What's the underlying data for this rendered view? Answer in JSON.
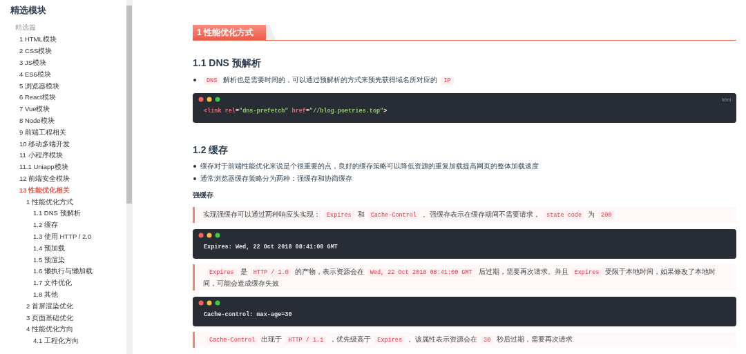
{
  "sidebar": {
    "title": "精选模块",
    "group": "精选篇",
    "items": [
      {
        "label": "1 HTML模块",
        "selected": false
      },
      {
        "label": "2 CSS模块",
        "selected": false
      },
      {
        "label": "3 JS模块",
        "selected": false
      },
      {
        "label": "4 ES6模块",
        "selected": false
      },
      {
        "label": "5 浏览器模块",
        "selected": false
      },
      {
        "label": "6 React模块",
        "selected": false
      },
      {
        "label": "7 Vue模块",
        "selected": false
      },
      {
        "label": "8 Node模块",
        "selected": false
      },
      {
        "label": "9 前端工程相关",
        "selected": false
      },
      {
        "label": "10 移动多端开发",
        "selected": false
      },
      {
        "label": "11 小程序模块",
        "selected": false
      },
      {
        "label": "11.1 Uniapp模块",
        "selected": false
      },
      {
        "label": "12 前端安全模块",
        "selected": false
      },
      {
        "label": "13 性能优化相关",
        "selected": true,
        "children": [
          {
            "label": "1 性能优化方式",
            "selected": false,
            "children": [
              {
                "label": "1.1 DNS 预解析",
                "selected": false
              },
              {
                "label": "1.2 缓存",
                "selected": false
              },
              {
                "label": "1.3 使用 HTTP / 2.0",
                "selected": false
              },
              {
                "label": "1.4 预加载",
                "selected": false
              },
              {
                "label": "1.5 预渲染",
                "selected": false
              },
              {
                "label": "1.6 懒执行与懒加载",
                "selected": false
              },
              {
                "label": "1.7 文件优化",
                "selected": false
              },
              {
                "label": "1.8 其他",
                "selected": false
              }
            ]
          },
          {
            "label": "2 首屏渲染优化",
            "selected": false
          },
          {
            "label": "3 页面基础优化",
            "selected": false
          },
          {
            "label": "4 性能优化方向",
            "selected": false,
            "children": [
              {
                "label": "4.1 工程化方向",
                "selected": false
              }
            ]
          }
        ]
      }
    ]
  },
  "article": {
    "blocks": [
      {
        "kind": "section_title",
        "text": "1 性能优化方式"
      },
      {
        "kind": "heading",
        "text": "1.1 DNS 预解析"
      },
      {
        "kind": "bullets",
        "items": [
          {
            "parts": [
              {
                "kind": "code",
                "text": "DNS"
              },
              {
                "kind": "text",
                "text": "解析也是需要时间的，可以通过预解析的方式来预先获得域名所对应的"
              },
              {
                "kind": "code",
                "text": "IP"
              }
            ]
          }
        ]
      },
      {
        "kind": "code",
        "language": "html",
        "lines": [
          [
            {
              "kind": "tag",
              "text": "<link"
            },
            {
              "kind": "attr",
              "text": "rel"
            },
            {
              "kind": "plain",
              "text": "="
            },
            {
              "kind": "string",
              "text": "\"dns-prefetch\""
            },
            {
              "kind": "attr",
              "text": "href"
            },
            {
              "kind": "plain",
              "text": "="
            },
            {
              "kind": "string",
              "text": "\"//blog.poetries.top\""
            },
            {
              "kind": "plain",
              "text": ">"
            }
          ]
        ]
      },
      {
        "kind": "heading",
        "text": "1.2 缓存"
      },
      {
        "kind": "bullets",
        "items": [
          {
            "parts": [
              {
                "kind": "text",
                "text": "缓存对于前端性能优化来说是个很重要的点，良好的缓存策略可以降低资源的重复加载提高网页的整体加载速度"
              }
            ]
          },
          {
            "parts": [
              {
                "kind": "text",
                "text": "通常浏览器缓存策略分为两种：强缓存和协商缓存"
              }
            ]
          }
        ]
      },
      {
        "kind": "subheading",
        "text": "强缓存"
      },
      {
        "kind": "quote",
        "parts": [
          {
            "kind": "text",
            "text": "实现强缓存可以通过两种响应头实现："
          },
          {
            "kind": "code",
            "text": "Expires"
          },
          {
            "kind": "text",
            "text": "和"
          },
          {
            "kind": "code",
            "text": "Cache-Control"
          },
          {
            "kind": "text",
            "text": "。强缓存表示在缓存期间不需要请求，"
          },
          {
            "kind": "code",
            "text": "state code"
          },
          {
            "kind": "text",
            "text": "为"
          },
          {
            "kind": "code",
            "text": "200"
          }
        ]
      },
      {
        "kind": "code",
        "lines": [
          [
            {
              "kind": "plain",
              "text": "Expires: Wed, 22 Oct 2018 08:41:00 GMT"
            }
          ]
        ]
      },
      {
        "kind": "quote",
        "parts": [
          {
            "kind": "code",
            "text": "Expires"
          },
          {
            "kind": "text",
            "text": "是"
          },
          {
            "kind": "code",
            "text": "HTTP / 1.0"
          },
          {
            "kind": "text",
            "text": "的产物，表示资源会在"
          },
          {
            "kind": "code",
            "text": "Wed, 22 Oct 2018 08:41:00 GMT"
          },
          {
            "kind": "text",
            "text": "后过期，需要再次请求。并且"
          },
          {
            "kind": "code",
            "text": "Expires"
          },
          {
            "kind": "text",
            "text": "受限于本地时间，如果修改了本地时间，可能会造成缓存失效"
          }
        ]
      },
      {
        "kind": "code",
        "lines": [
          [
            {
              "kind": "plain",
              "text": "Cache-control: max-age=30"
            }
          ]
        ]
      },
      {
        "kind": "quote",
        "parts": [
          {
            "kind": "code",
            "text": "Cache-Control"
          },
          {
            "kind": "text",
            "text": "出现于"
          },
          {
            "kind": "code",
            "text": "HTTP / 1.1"
          },
          {
            "kind": "text",
            "text": "，优先级高于"
          },
          {
            "kind": "code",
            "text": "Expires"
          },
          {
            "kind": "text",
            "text": "。该属性表示资源会在"
          },
          {
            "kind": "code",
            "text": "30"
          },
          {
            "kind": "text",
            "text": "秒后过期，需要再次请求"
          }
        ]
      }
    ]
  }
}
